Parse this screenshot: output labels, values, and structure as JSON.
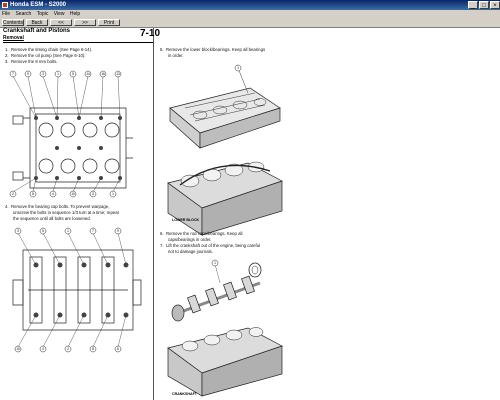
{
  "window": {
    "title": "Honda ESM - S2000",
    "controls": [
      "_",
      "□",
      "×"
    ]
  },
  "menu": [
    "File",
    "Search",
    "Topic",
    "View",
    "Help"
  ],
  "toolbar": {
    "contents": "Contents",
    "back": "Back",
    "prev": "<<",
    "next": ">>",
    "print": "Print"
  },
  "page": {
    "section_title": "Crankshaft and Pistons",
    "section_subtitle": "Removal",
    "page_number": "7-10",
    "step1": "Remove the timing chain (See Page 6-14).",
    "step2": "Remove the oil pump (See Page 6-10).",
    "step3": "Remove the 8 mm bolts.",
    "step4a": "Remove the bearing cap bolts. To prevent warpage,",
    "step4b": "unscrew the bolts in sequence 1/3 turn at a time; repeat",
    "step4c": "the sequence until all bolts are loosened.",
    "step5a": "Remove the lower block/bearings. Keep all bearings",
    "step5b": "in order.",
    "step6a": "Remove the rod caps/bearings. Keep all",
    "step6b": "caps/bearings in order.",
    "step7a": "Lift the crankshaft out of the engine, being careful",
    "step7b": "not to damage journals.",
    "caption_lower_block": "LOWER BLOCK",
    "caption_crankshaft": "CRANKSHAFT"
  },
  "diagram1_callouts": [
    "7",
    "9",
    "3",
    "1",
    "5",
    "14",
    "16",
    "13",
    "11",
    "12",
    "15",
    "10",
    "17",
    "18",
    "6",
    "2",
    "8",
    "4",
    "10",
    "3",
    "1",
    "5",
    "9",
    "7",
    "3"
  ],
  "diagram2_callouts": [
    "3",
    "5",
    "1",
    "7",
    "9",
    "10",
    "4",
    "2",
    "8",
    "6"
  ]
}
